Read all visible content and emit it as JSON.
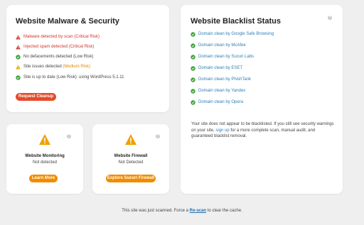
{
  "malware": {
    "title": "Website Malware & Security",
    "items": [
      {
        "status": "warn-red",
        "icon": "warning-icon",
        "text": "Malware detected by scan (Critical Risk)",
        "color": "#d0342c"
      },
      {
        "status": "warn-red",
        "icon": "warning-icon",
        "text": "Injected spam detected (Critical Risk)",
        "color": "#d0342c"
      },
      {
        "status": "ok",
        "icon": "check-icon",
        "text": "No defacements detected (Low Risk)",
        "color": "#444444"
      },
      {
        "status": "warn-orange",
        "icon": "warning-icon",
        "text": "Site issues detected (Medium Risk)",
        "color": "#e08a00"
      },
      {
        "status": "ok",
        "icon": "check-icon",
        "text": "Site is up to date (Low Risk): using WordPress 5.1.11",
        "color": "#444444"
      }
    ],
    "button_label": "Request Cleanup"
  },
  "blacklist": {
    "title": "Website Blacklist Status",
    "items": [
      "Domain clean by Google Safe Browsing",
      "Domain clean by McAfee",
      "Domain clean by Sucuri Labs",
      "Domain clean by ESET",
      "Domain clean by PhishTank",
      "Domain clean by Yandex",
      "Domain clean by Opera"
    ],
    "note_part1": "Your site does not appear to be blacklisted. If you still see security warnings on your site, ",
    "note_link": "sign up",
    "note_part2": " for a more complete scan, manual audit, and guaranteed blacklist removal."
  },
  "monitoring": {
    "title": "Website Monitoring",
    "status": "Not detected",
    "button_label": "Learn More"
  },
  "firewall": {
    "title": "Website Firewall",
    "status": "Not Detected",
    "button_label": "Explore Sucuri Firewall"
  },
  "footer": {
    "prefix": "This site was just scanned. Force a ",
    "link": "Re-scan",
    "suffix": " to clear the cache."
  },
  "colors": {
    "critical": "#d0342c",
    "medium": "#e08a00",
    "ok": "#3ea33a",
    "link": "#2e7fb8",
    "button_red": "#e34b2a",
    "button_orange": "#f08c00"
  }
}
